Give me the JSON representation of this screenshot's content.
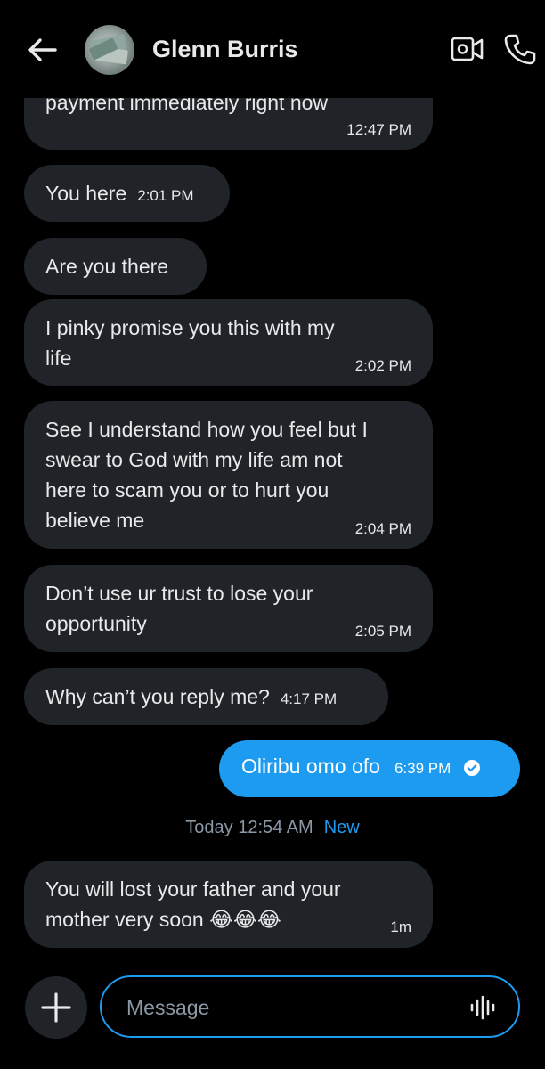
{
  "header": {
    "contact_name": "Glenn Burris"
  },
  "messages": [
    {
      "text": "payment immediately right now",
      "time": "12:47 PM"
    },
    {
      "text": "You here",
      "time": "2:01 PM"
    },
    {
      "text": "Are you there",
      "time": ""
    },
    {
      "text_lines": [
        "I pinky promise you this with my",
        "life"
      ],
      "time": "2:02 PM"
    },
    {
      "text_lines": [
        "See I understand how you feel but I",
        "swear to God with my life am not",
        "here to scam you or to hurt you",
        "believe me"
      ],
      "time": "2:04 PM"
    },
    {
      "text_lines": [
        "Don’t use ur trust to lose your",
        "opportunity"
      ],
      "time": "2:05 PM"
    },
    {
      "text": "Why can’t you reply me?",
      "time": "4:17 PM"
    }
  ],
  "sent_message": {
    "text": "Oliribu omo ofo",
    "time": "6:39 PM"
  },
  "divider": {
    "label": "Today 12:54 AM",
    "badge": "New"
  },
  "latest_message": {
    "text_lines": [
      "You will lost your father and your",
      "mother very soon 😂😂😂"
    ],
    "time": "1m"
  },
  "composer": {
    "placeholder": "Message"
  },
  "colors": {
    "accent": "#1d9bf0",
    "bubble": "#202327",
    "background": "#000000"
  }
}
